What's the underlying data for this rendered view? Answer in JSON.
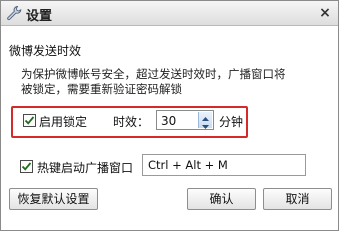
{
  "window": {
    "title": "设置",
    "icon": "wrench-icon",
    "close_glyph": "×"
  },
  "section": {
    "heading": "微博发送时效",
    "description_line1": "为保护微博帐号安全，超过发送时效时，广播窗口将",
    "description_line2": "被锁定，需要重新验证密码解锁"
  },
  "lock": {
    "checked": true,
    "label": "启用锁定",
    "timeout_label": "时效：",
    "timeout_value": "30",
    "unit": "分钟"
  },
  "hotkey": {
    "checked": true,
    "label": "热键启动广播窗口",
    "value": "Ctrl + Alt + M"
  },
  "buttons": {
    "restore_defaults": "恢复默认设置",
    "ok": "确认",
    "cancel": "取消"
  },
  "colors": {
    "highlight_border": "#d42a2a",
    "checkmark": "#1f6b1f"
  }
}
